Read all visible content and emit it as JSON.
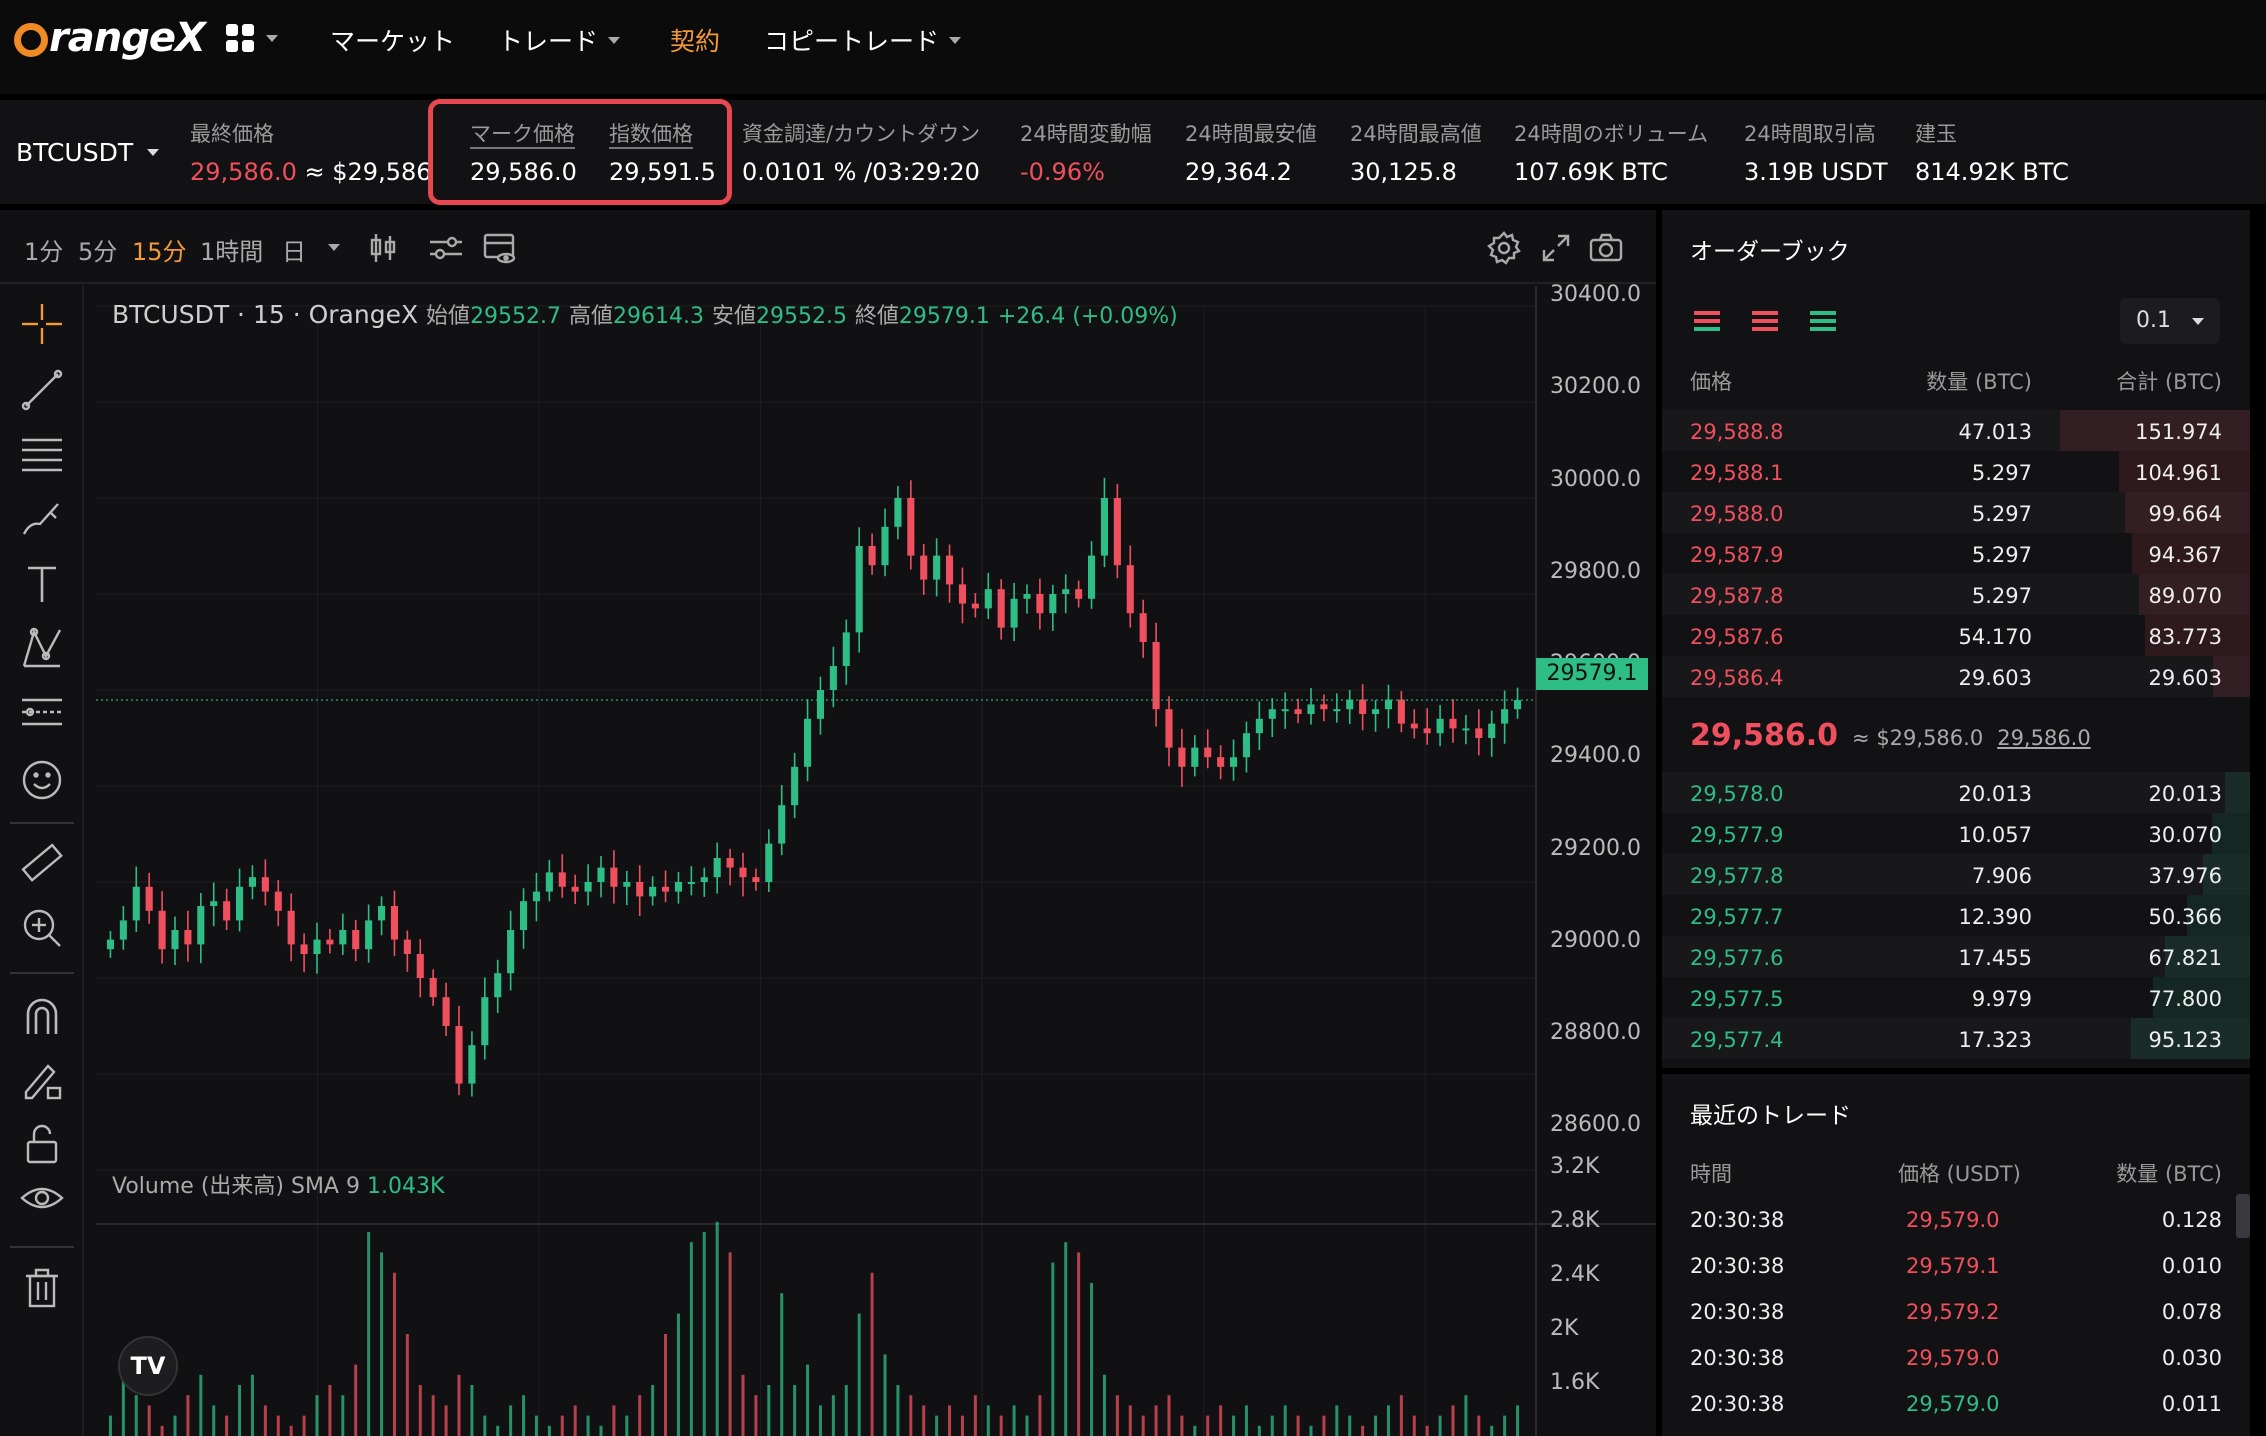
{
  "nav": {
    "logo_text": "rangeX",
    "items": [
      {
        "label": "マーケット",
        "caret": false,
        "active": false
      },
      {
        "label": "トレード",
        "caret": true,
        "active": false
      },
      {
        "label": "契約",
        "caret": false,
        "active": true
      },
      {
        "label": "コピートレード",
        "caret": true,
        "active": false
      }
    ]
  },
  "ticker": {
    "symbol": "BTCUSDT",
    "last_price_label": "最終価格",
    "last_price": "29,586.0",
    "last_price_usd": "≈ $29,586.0",
    "mark_label": "マーク価格",
    "mark_value": "29,586.0",
    "index_label": "指数価格",
    "index_value": "29,591.5",
    "funding_label": "資金調達/カウントダウン",
    "funding_value": "0.0101 % /03:29:20",
    "change_label": "24時間変動幅",
    "change_value": "-0.96%",
    "low_label": "24時間最安値",
    "low_value": "29,364.2",
    "high_label": "24時間最高値",
    "high_value": "30,125.8",
    "volume_label": "24時間のボリューム",
    "volume_value": "107.69K BTC",
    "turnover_label": "24時間取引高",
    "turnover_value": "3.19B USDT",
    "oi_label": "建玉",
    "oi_value": "814.92K BTC"
  },
  "chart": {
    "timeframes": [
      "1分",
      "5分",
      "15分",
      "1時間",
      "日"
    ],
    "active_timeframe": "15分",
    "legend_title": "BTCUSDT · 15 · OrangeX",
    "open_label": "始値",
    "open": "29552.7",
    "high_label": "高値",
    "high": "29614.3",
    "low_label": "安値",
    "low": "29552.5",
    "close_label": "終値",
    "close": "29579.1",
    "change": "+26.4 (+0.09%)",
    "last_tag": "29579.1",
    "volume_legend": "Volume (出来高)",
    "volume_sma": "SMA 9",
    "volume_sma_value": "1.043K",
    "price_ticks": [
      "30400.0",
      "30200.0",
      "30000.0",
      "29800.0",
      "29600.0",
      "29400.0",
      "29200.0",
      "29000.0",
      "28800.0",
      "28600.0"
    ],
    "volume_ticks": [
      "3.2K",
      "2.8K",
      "2.4K",
      "2K",
      "1.6K"
    ],
    "tv_badge": "TV"
  },
  "chart_data": {
    "type": "candlestick",
    "title": "BTCUSDT · 15 · OrangeX",
    "ylim": [
      28600,
      30400
    ],
    "close_series": [
      29080,
      29120,
      29190,
      29140,
      29060,
      29100,
      29070,
      29150,
      29160,
      29120,
      29190,
      29210,
      29180,
      29140,
      29070,
      29050,
      29080,
      29070,
      29100,
      29060,
      29120,
      29150,
      29080,
      29050,
      29000,
      28960,
      28900,
      28780,
      28860,
      28960,
      29010,
      29100,
      29160,
      29180,
      29220,
      29190,
      29180,
      29200,
      29230,
      29190,
      29200,
      29170,
      29190,
      29180,
      29200,
      29200,
      29210,
      29250,
      29230,
      29210,
      29200,
      29280,
      29360,
      29440,
      29540,
      29600,
      29650,
      29720,
      29900,
      29860,
      29940,
      30000,
      29880,
      29830,
      29880,
      29820,
      29780,
      29770,
      29810,
      29730,
      29790,
      29800,
      29760,
      29800,
      29810,
      29790,
      29880,
      30000,
      29860,
      29760,
      29700,
      29560,
      29480,
      29440,
      29480,
      29460,
      29440,
      29460,
      29510,
      29540,
      29560,
      29560,
      29550,
      29570,
      29560,
      29560,
      29580,
      29550,
      29560,
      29580,
      29530,
      29520,
      29510,
      29540,
      29520,
      29520,
      29500,
      29530,
      29560,
      29579
    ],
    "volume_series": [
      1.6,
      2.1,
      1.8,
      1.7,
      1.5,
      1.6,
      1.8,
      2.0,
      1.7,
      1.6,
      1.9,
      2.0,
      1.7,
      1.6,
      1.5,
      1.6,
      1.8,
      1.9,
      1.8,
      2.1,
      3.4,
      3.2,
      3.0,
      2.4,
      1.9,
      1.8,
      1.7,
      2.0,
      1.9,
      1.6,
      1.5,
      1.7,
      1.8,
      1.6,
      1.5,
      1.6,
      1.7,
      1.6,
      1.5,
      1.7,
      1.6,
      1.8,
      1.9,
      2.4,
      2.6,
      3.3,
      3.4,
      3.5,
      3.2,
      2.0,
      1.8,
      1.9,
      2.8,
      1.9,
      2.1,
      1.7,
      1.8,
      1.9,
      2.6,
      3.0,
      2.2,
      1.9,
      1.8,
      1.7,
      1.6,
      1.7,
      1.6,
      1.8,
      1.7,
      1.6,
      1.7,
      1.6,
      1.8,
      3.1,
      3.3,
      3.2,
      2.9,
      2.0,
      1.8,
      1.7,
      1.6,
      1.7,
      1.8,
      1.6,
      1.5,
      1.6,
      1.7,
      1.6,
      1.7,
      1.5,
      1.6,
      1.7,
      1.6,
      1.5,
      1.6,
      1.7,
      1.6,
      1.5,
      1.6,
      1.7,
      1.8,
      1.6,
      1.5,
      1.6,
      1.7,
      1.8,
      1.6,
      1.5,
      1.6,
      1.7
    ]
  },
  "orderbook": {
    "title": "オーダーブック",
    "precision": "0.1",
    "col_price": "価格",
    "col_qty": "数量 (BTC)",
    "col_total": "合計 (BTC)",
    "asks": [
      {
        "price": "29,588.8",
        "qty": "47.013",
        "total": "151.974"
      },
      {
        "price": "29,588.1",
        "qty": "5.297",
        "total": "104.961"
      },
      {
        "price": "29,588.0",
        "qty": "5.297",
        "total": "99.664"
      },
      {
        "price": "29,587.9",
        "qty": "5.297",
        "total": "94.367"
      },
      {
        "price": "29,587.8",
        "qty": "5.297",
        "total": "89.070"
      },
      {
        "price": "29,587.6",
        "qty": "54.170",
        "total": "83.773"
      },
      {
        "price": "29,586.4",
        "qty": "29.603",
        "total": "29.603"
      }
    ],
    "mid_price": "29,586.0",
    "mid_usd": "≈ $29,586.0",
    "mid_mark": "29,586.0",
    "bids": [
      {
        "price": "29,578.0",
        "qty": "20.013",
        "total": "20.013"
      },
      {
        "price": "29,577.9",
        "qty": "10.057",
        "total": "30.070"
      },
      {
        "price": "29,577.8",
        "qty": "7.906",
        "total": "37.976"
      },
      {
        "price": "29,577.7",
        "qty": "12.390",
        "total": "50.366"
      },
      {
        "price": "29,577.6",
        "qty": "17.455",
        "total": "67.821"
      },
      {
        "price": "29,577.5",
        "qty": "9.979",
        "total": "77.800"
      },
      {
        "price": "29,577.4",
        "qty": "17.323",
        "total": "95.123"
      }
    ]
  },
  "trades": {
    "title": "最近のトレード",
    "col_time": "時間",
    "col_price": "価格 (USDT)",
    "col_qty": "数量 (BTC)",
    "rows": [
      {
        "time": "20:30:38",
        "price": "29,579.0",
        "qty": "0.128",
        "side": "sell"
      },
      {
        "time": "20:30:38",
        "price": "29,579.1",
        "qty": "0.010",
        "side": "sell"
      },
      {
        "time": "20:30:38",
        "price": "29,579.2",
        "qty": "0.078",
        "side": "sell"
      },
      {
        "time": "20:30:38",
        "price": "29,579.0",
        "qty": "0.030",
        "side": "sell"
      },
      {
        "time": "20:30:38",
        "price": "29,579.0",
        "qty": "0.011",
        "side": "buy"
      }
    ]
  },
  "colors": {
    "accent": "#f39a36",
    "up": "#2ebd85",
    "down": "#f0505e",
    "highlight": "#e8474f"
  }
}
